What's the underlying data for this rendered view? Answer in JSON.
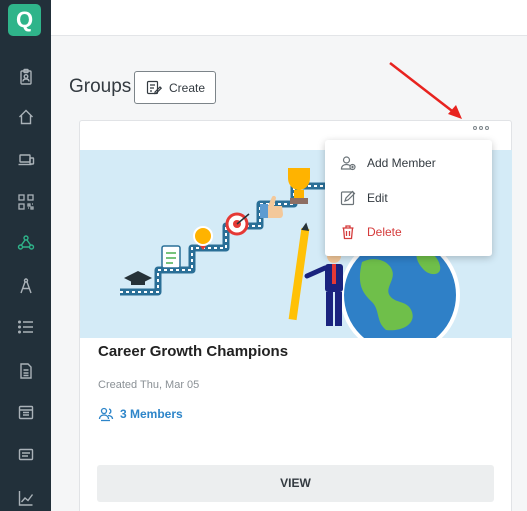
{
  "app": {
    "logo_letter": "Q",
    "brand_color": "#2fb48a"
  },
  "sidebar": {
    "items": [
      {
        "icon": "id-badge-icon"
      },
      {
        "icon": "home-icon"
      },
      {
        "icon": "laptop-icon"
      },
      {
        "icon": "qr-code-icon"
      },
      {
        "icon": "groups-icon",
        "active": true
      },
      {
        "icon": "compass-icon"
      },
      {
        "icon": "list-icon"
      },
      {
        "icon": "document-icon"
      },
      {
        "icon": "calendar-icon"
      },
      {
        "icon": "chat-icon"
      },
      {
        "icon": "chart-icon"
      }
    ]
  },
  "header": {
    "title": "Groups",
    "create_label": "Create"
  },
  "card": {
    "title": "Career Growth Champions",
    "created": "Created Thu, Mar 05",
    "members": "3 Members",
    "view_label": "VIEW"
  },
  "menu": {
    "items": [
      {
        "label": "Add Member",
        "icon": "add-user-icon"
      },
      {
        "label": "Edit",
        "icon": "edit-icon"
      },
      {
        "label": "Delete",
        "icon": "trash-icon",
        "color": "#d53b3b"
      }
    ]
  },
  "colors": {
    "link": "#2d85c9",
    "danger": "#d53b3b",
    "annotation_arrow": "#e8231f"
  }
}
